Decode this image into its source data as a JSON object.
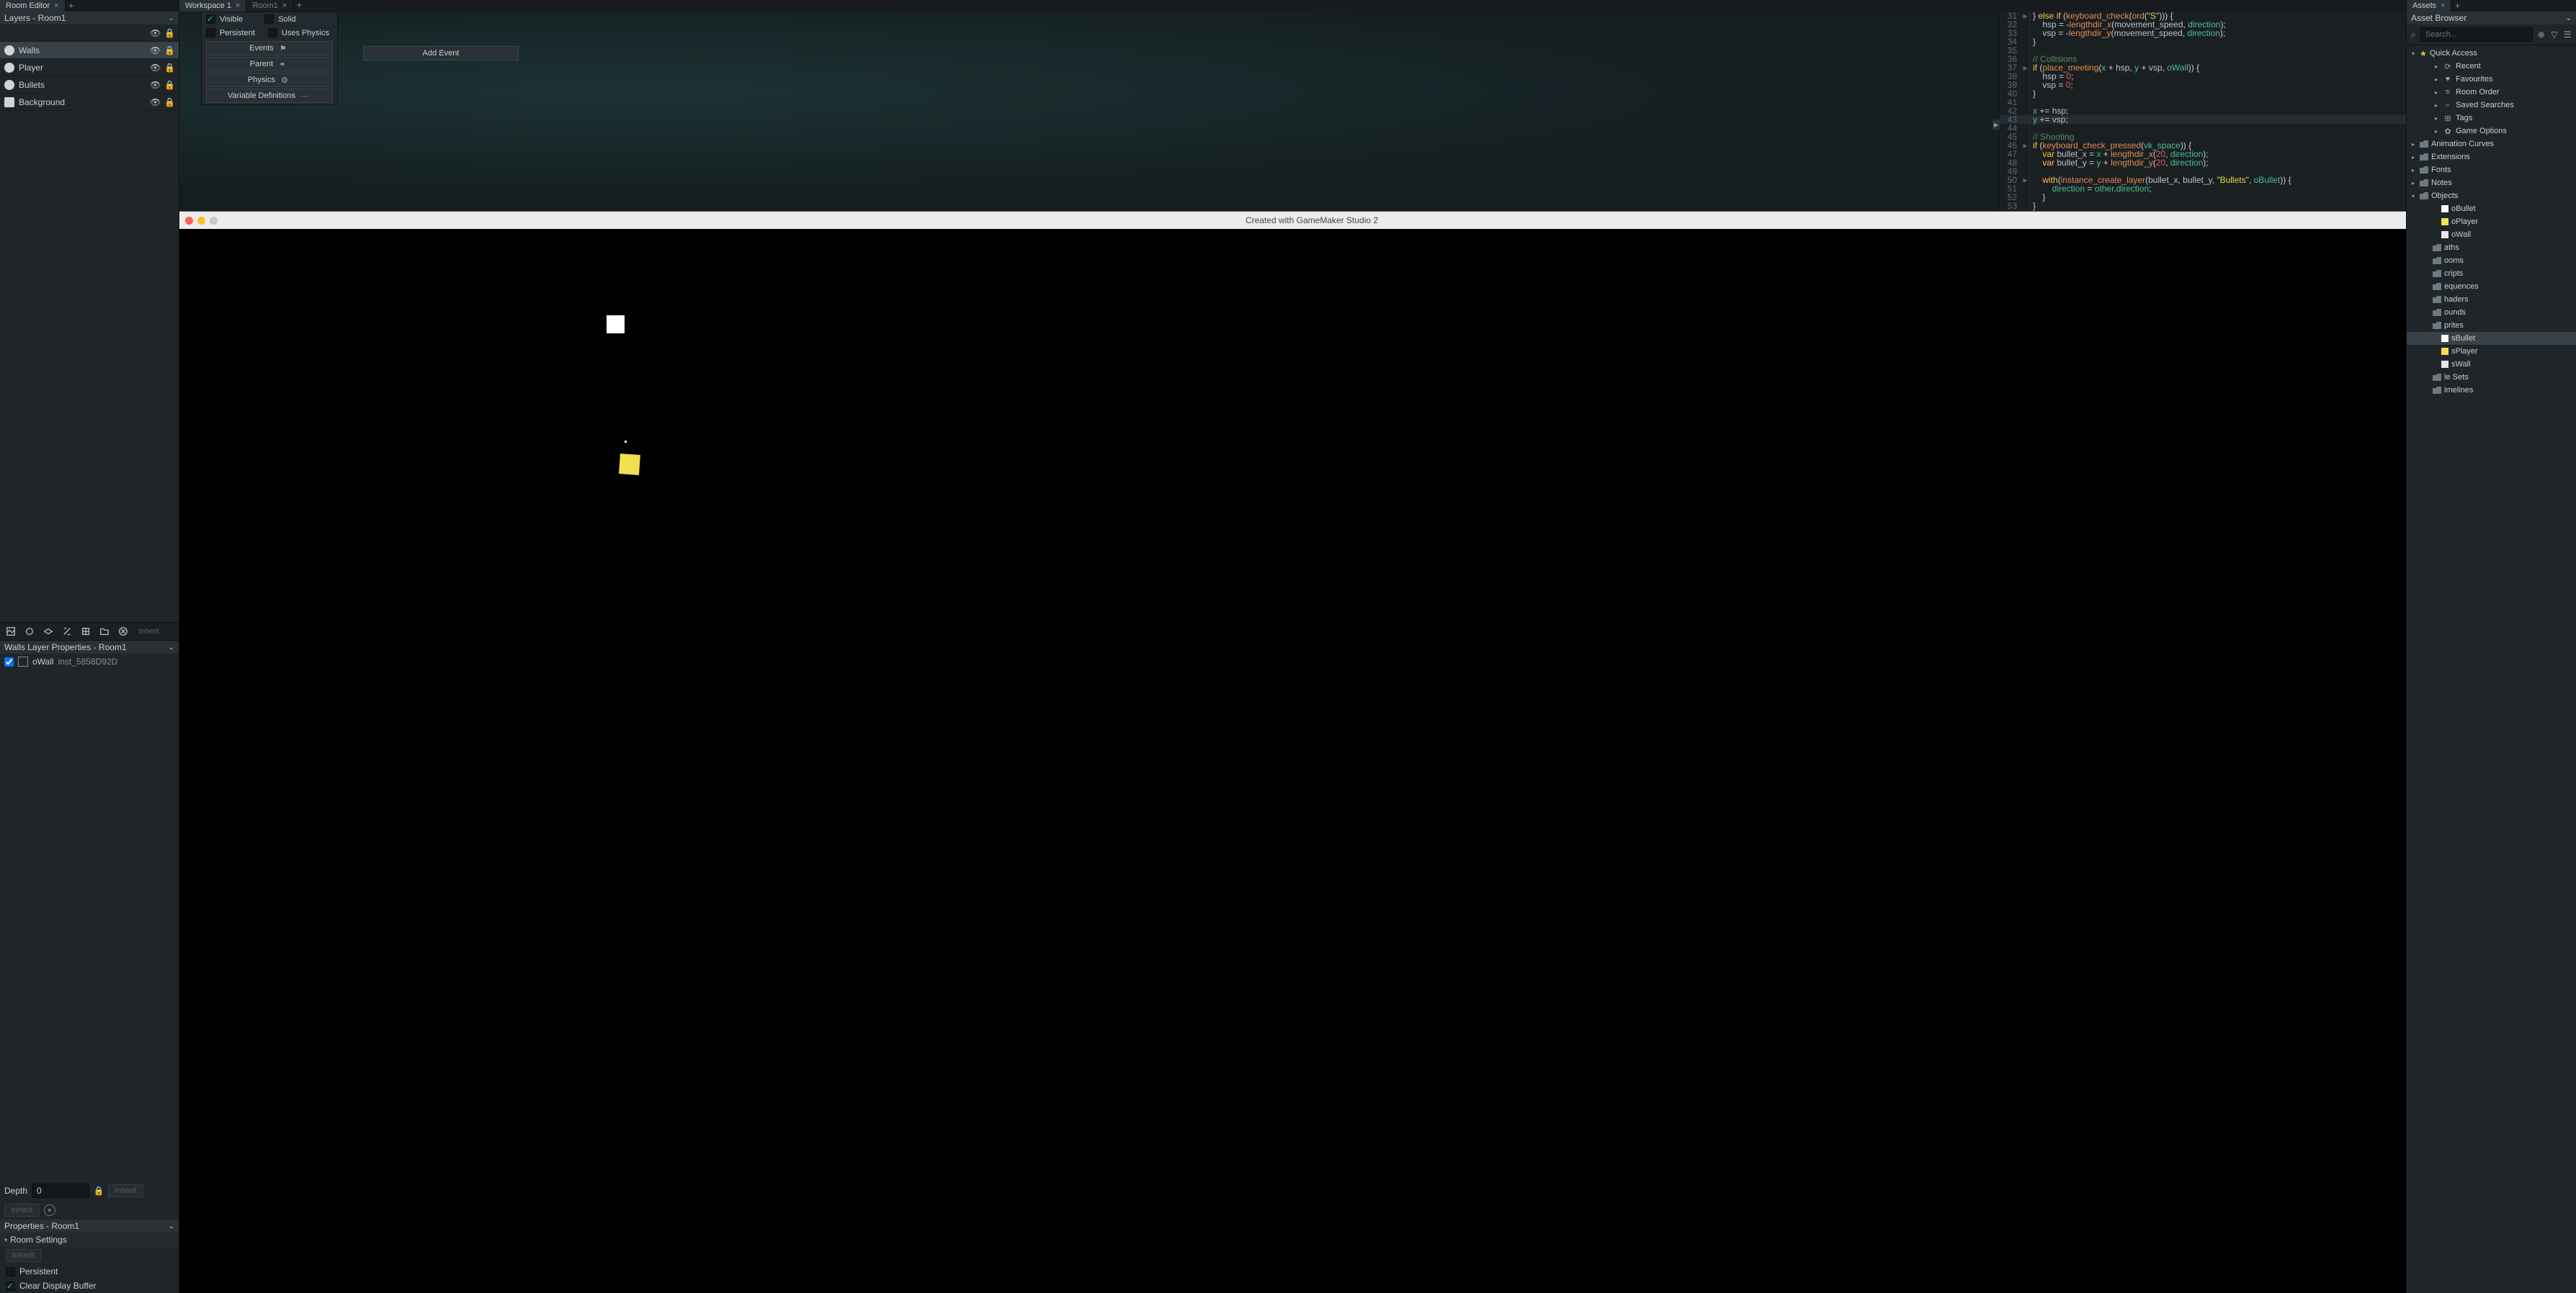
{
  "left": {
    "tab": "Room Editor",
    "layersHeader": "Layers - Room1",
    "layers": [
      {
        "name": "Walls"
      },
      {
        "name": "Player"
      },
      {
        "name": "Bullets"
      },
      {
        "name": "Background"
      }
    ],
    "inheritTool": "Inherit",
    "propsHeader": "Walls Layer Properties - Room1",
    "instance": {
      "obj": "oWall",
      "name": "inst_5858D92D"
    },
    "depthLabel": "Depth",
    "depthValue": "0",
    "inheritBtn": "Inherit",
    "propsRoomHeader": "Properties - Room1",
    "roomSettings": "Room Settings",
    "inheritBtn2": "Inherit",
    "persistent": "Persistent",
    "clearDisplay": "Clear Display Buffer"
  },
  "midTabs": {
    "ws": "Workspace 1",
    "room": "Room1"
  },
  "objPanel": {
    "visible": "Visible",
    "solid": "Solid",
    "persistent": "Persistent",
    "uses": "Uses Physics",
    "events": "Events",
    "parent": "Parent",
    "physics": "Physics",
    "vardef": "Variable Definitions"
  },
  "addEvent": "Add Event",
  "code": {
    "lines": [
      {
        "n": 31,
        "fold": "▸",
        "cls": "",
        "html": "} <span class='kw'>else if</span> <span class='op'>(</span><span class='fn'>keyboard_check</span><span class='op'>(</span><span class='fn'>ord</span><span class='op'>(</span><span class='str'>\"S\"</span><span class='op'>))) {</span>"
      },
      {
        "n": 32,
        "fold": "",
        "cls": "",
        "html": "    <span class='var'>hsp</span> <span class='op'>=</span> <span class='op'>-</span><span class='fn'>lengthdir_x</span><span class='op'>(</span><span class='var'>movement_speed</span><span class='op'>,</span> <span class='res'>direction</span><span class='op'>);</span>"
      },
      {
        "n": 33,
        "fold": "",
        "cls": "",
        "html": "    <span class='var'>vsp</span> <span class='op'>=</span> <span class='op'>-</span><span class='fn'>lengthdir_y</span><span class='op'>(</span><span class='var'>movement_speed</span><span class='op'>,</span> <span class='res'>direction</span><span class='op'>);</span>"
      },
      {
        "n": 34,
        "fold": "",
        "cls": "",
        "html": "<span class='op'>}</span>"
      },
      {
        "n": 35,
        "fold": "",
        "cls": "",
        "html": ""
      },
      {
        "n": 36,
        "fold": "",
        "cls": "",
        "html": "<span class='cm'>// Collisions</span>"
      },
      {
        "n": 37,
        "fold": "▸",
        "cls": "",
        "html": "<span class='kw'>if</span> <span class='op'>(</span><span class='fn'>place_meeting</span><span class='op'>(</span><span class='res'>x</span> <span class='op'>+</span> <span class='var'>hsp</span><span class='op'>,</span> <span class='res'>y</span> <span class='op'>+</span> <span class='var'>vsp</span><span class='op'>,</span> <span class='res'>oWall</span><span class='op'>)) {</span>"
      },
      {
        "n": 38,
        "fold": "",
        "cls": "",
        "html": "    <span class='var'>hsp</span> <span class='op'>=</span> <span class='num'>0</span><span class='op'>;</span>"
      },
      {
        "n": 39,
        "fold": "",
        "cls": "",
        "html": "    <span class='var'>vsp</span> <span class='op'>=</span> <span class='num'>0</span><span class='op'>;</span>"
      },
      {
        "n": 40,
        "fold": "",
        "cls": "",
        "html": "<span class='op'>}</span>"
      },
      {
        "n": 41,
        "fold": "",
        "cls": "",
        "html": ""
      },
      {
        "n": 42,
        "fold": "",
        "cls": "",
        "html": "<span class='res'>x</span> <span class='op'>+=</span> <span class='var'>hsp</span><span class='op'>;</span>"
      },
      {
        "n": 43,
        "fold": "",
        "cls": "hl",
        "html": "<span class='res'>y</span> <span class='op'>+=</span> <span class='var'>vsp</span><span class='op'>;</span>"
      },
      {
        "n": 44,
        "fold": "",
        "cls": "",
        "html": ""
      },
      {
        "n": 45,
        "fold": "",
        "cls": "",
        "html": "<span class='cm'>// Shooting</span>"
      },
      {
        "n": 46,
        "fold": "▸",
        "cls": "",
        "html": "<span class='kw'>if</span> <span class='op'>(</span><span class='fn'>keyboard_check_pressed</span><span class='op'>(</span><span class='res'>vk_space</span><span class='op'>)) {</span>"
      },
      {
        "n": 47,
        "fold": "",
        "cls": "",
        "html": "    <span class='kw'>var</span> <span class='var'>bullet_x</span> <span class='op'>=</span> <span class='res'>x</span> <span class='op'>+</span> <span class='fn'>lengthdir_x</span><span class='op'>(</span><span class='num'>20</span><span class='op'>,</span> <span class='res'>direction</span><span class='op'>);</span>"
      },
      {
        "n": 48,
        "fold": "",
        "cls": "",
        "html": "    <span class='kw'>var</span> <span class='var'>bullet_y</span> <span class='op'>=</span> <span class='res'>y</span> <span class='op'>+</span> <span class='fn'>lengthdir_y</span><span class='op'>(</span><span class='num'>20</span><span class='op'>,</span> <span class='res'>direction</span><span class='op'>);</span>"
      },
      {
        "n": 49,
        "fold": "",
        "cls": "",
        "html": ""
      },
      {
        "n": 50,
        "fold": "▸",
        "cls": "",
        "html": "    <span class='kw'>with</span><span class='op'>(</span><span class='fn'>instance_create_layer</span><span class='op'>(</span><span class='var'>bullet_x</span><span class='op'>,</span> <span class='var'>bullet_y</span><span class='op'>,</span> <span class='str'>\"Bullets\"</span><span class='op'>,</span> <span class='res'>oBullet</span><span class='op'>)) {</span>"
      },
      {
        "n": 51,
        "fold": "",
        "cls": "",
        "html": "        <span class='res'>direction</span> <span class='op'>=</span> <span class='res'>other</span><span class='op'>.</span><span class='res'>direction</span><span class='op'>;</span>"
      },
      {
        "n": 52,
        "fold": "",
        "cls": "",
        "html": "    <span class='op'>}</span>"
      },
      {
        "n": 53,
        "fold": "",
        "cls": "",
        "html": "<span class='op'>}</span>"
      }
    ]
  },
  "gameTitle": "Created with GameMaker Studio 2",
  "right": {
    "tab": "Assets",
    "header": "Asset Browser",
    "searchPH": "Search...",
    "quickAccess": "Quick Access",
    "qa": [
      {
        "icon": "⟳",
        "label": "Recent"
      },
      {
        "icon": "♥",
        "label": "Favourites"
      },
      {
        "icon": "≡",
        "label": "Room Order"
      },
      {
        "icon": "⌕",
        "label": "Saved Searches"
      },
      {
        "icon": "⊞",
        "label": "Tags"
      },
      {
        "icon": "✿",
        "label": "Game Options"
      }
    ],
    "folders": [
      {
        "label": "Animation Curves",
        "open": false
      },
      {
        "label": "Extensions",
        "open": false
      },
      {
        "label": "Fonts",
        "open": false
      },
      {
        "label": "Notes",
        "open": false
      }
    ],
    "objects": {
      "label": "Objects",
      "items": [
        {
          "ic": "s-bullet",
          "label": "oBullet"
        },
        {
          "ic": "s-player",
          "label": "oPlayer"
        },
        {
          "ic": "s-wall",
          "label": "oWall"
        }
      ]
    },
    "folders2": [
      {
        "label": "aths"
      },
      {
        "label": "ooms"
      },
      {
        "label": "cripts"
      },
      {
        "label": "equences"
      },
      {
        "label": "haders"
      },
      {
        "label": "ounds"
      }
    ],
    "sprites": {
      "label": "prites",
      "items": [
        {
          "ic": "s-bullet",
          "label": "sBullet",
          "sel": true
        },
        {
          "ic": "s-player",
          "label": "sPlayer"
        },
        {
          "ic": "s-wall",
          "label": "sWall"
        }
      ]
    },
    "folders3": [
      {
        "label": "le Sets"
      },
      {
        "label": "imelines"
      }
    ]
  }
}
